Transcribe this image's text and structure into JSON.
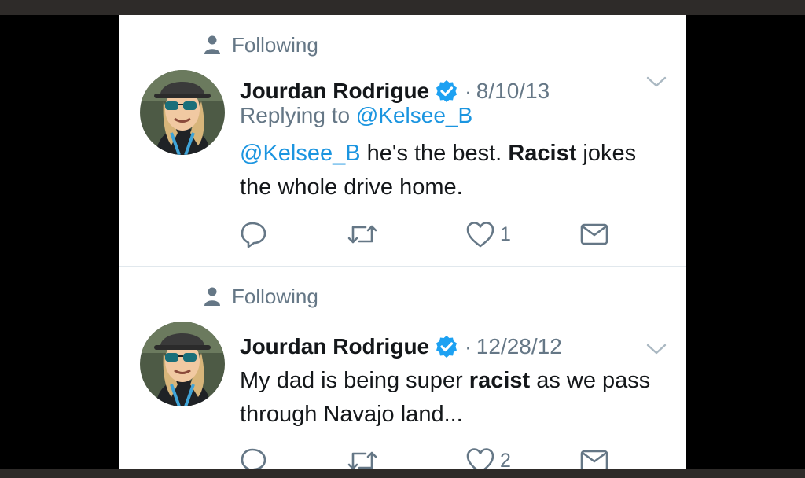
{
  "tweets": [
    {
      "social_context": "Following",
      "author_name": "Jourdan Rodrigue",
      "separator": "·",
      "date": "8/10/13",
      "replying_to_prefix": "Replying to",
      "replying_to_handle": "@Kelsee_B",
      "body_segments": [
        {
          "text": "@Kelsee_B",
          "style": "mention"
        },
        {
          "text": " he's the best. ",
          "style": "normal"
        },
        {
          "text": "Racist",
          "style": "bold"
        },
        {
          "text": " jokes the whole drive home.",
          "style": "normal"
        }
      ],
      "reply_count": "",
      "retweet_count": "",
      "like_count": "1",
      "icons": [
        "person-icon",
        "verified-badge-icon",
        "chevron-down-icon",
        "reply-icon",
        "retweet-icon",
        "like-heart-icon",
        "direct-message-icon"
      ]
    },
    {
      "social_context": "Following",
      "author_name": "Jourdan Rodrigue",
      "separator": "·",
      "date": "12/28/12",
      "body_segments": [
        {
          "text": "My dad is being super ",
          "style": "normal"
        },
        {
          "text": "racist",
          "style": "bold"
        },
        {
          "text": " as we pass through Navajo land...",
          "style": "normal"
        }
      ],
      "reply_count": "",
      "retweet_count": "",
      "like_count": "2",
      "icons": [
        "person-icon",
        "verified-badge-icon",
        "chevron-down-icon",
        "reply-icon",
        "retweet-icon",
        "like-heart-icon",
        "direct-message-icon"
      ]
    }
  ],
  "colors": {
    "mention_blue": "#1b95e0",
    "verified_blue": "#1da1f2",
    "gray_text": "#657786",
    "icon_gray": "#657786",
    "text_dark": "#14171a",
    "divider": "#e1e8ed",
    "frame_dark": "#2e2b29"
  }
}
